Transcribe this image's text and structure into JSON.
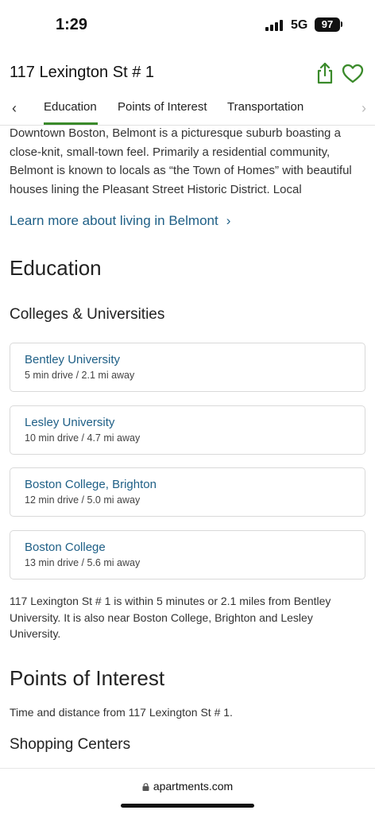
{
  "status_bar": {
    "time": "1:29",
    "network": "5G",
    "battery": "97"
  },
  "header": {
    "title": "117 Lexington St # 1",
    "share_icon": "share-icon",
    "favorite_icon": "heart-icon",
    "accent_color": "#3a8a2a"
  },
  "tabs": {
    "items": [
      {
        "label": "Education",
        "active": true
      },
      {
        "label": "Points of Interest",
        "active": false
      },
      {
        "label": "Transportation",
        "active": false
      }
    ],
    "left_arrow": "‹",
    "right_arrow": "›"
  },
  "intro": {
    "text": "Downtown Boston, Belmont is a picturesque suburb boasting a close-knit, small-town feel. Primarily a residential community, Belmont is known to locals as “the Town of Homes” with beautiful houses lining the Pleasant Street Historic District. Local"
  },
  "learn_more": {
    "label": "Learn more about living in Belmont",
    "chevron": "›"
  },
  "education": {
    "heading": "Education",
    "subheading": "Colleges & Universities",
    "schools": [
      {
        "name": "Bentley University",
        "meta": "5 min drive / 2.1 mi away"
      },
      {
        "name": "Lesley University",
        "meta": "10 min drive / 4.7 mi away"
      },
      {
        "name": "Boston College, Brighton",
        "meta": "12 min drive / 5.0 mi away"
      },
      {
        "name": "Boston College",
        "meta": "13 min drive / 5.6 mi away"
      }
    ],
    "summary": "117 Lexington St # 1 is within 5 minutes or 2.1 miles from Bentley University. It is also near Boston College, Brighton and Lesley University."
  },
  "points_of_interest": {
    "heading": "Points of Interest",
    "description": "Time and distance from 117 Lexington St # 1.",
    "subheading": "Shopping Centers"
  },
  "browser": {
    "url": "apartments.com"
  }
}
